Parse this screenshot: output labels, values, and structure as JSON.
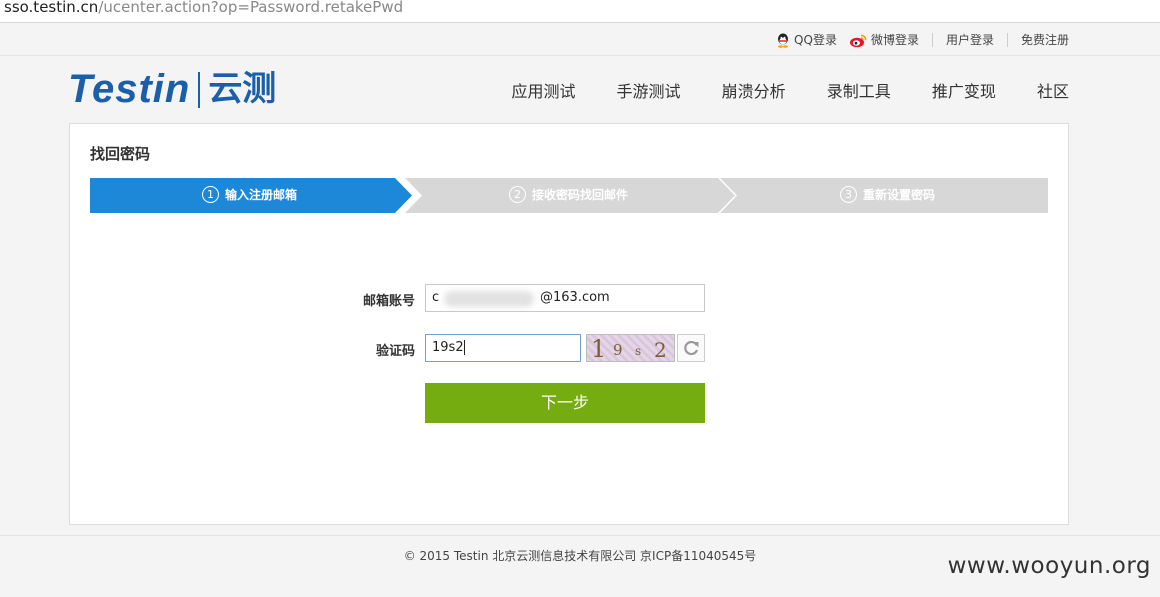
{
  "browser": {
    "url_host": "sso.testin.cn",
    "url_path": "/ucenter.action?op=Password.retakePwd"
  },
  "topbar": {
    "qq_login": "QQ登录",
    "weibo_login": "微博登录",
    "user_login": "用户登录",
    "free_register": "免费注册"
  },
  "logo": {
    "en": "Testin",
    "cn": "云测"
  },
  "nav": {
    "items": [
      "应用测试",
      "手游测试",
      "崩溃分析",
      "录制工具",
      "推广变现",
      "社区"
    ]
  },
  "panel": {
    "title": "找回密码",
    "steps": [
      {
        "num": "1",
        "label": "输入注册邮箱",
        "state": "active"
      },
      {
        "num": "2",
        "label": "接收密码找回邮件",
        "state": "inactive"
      },
      {
        "num": "3",
        "label": "重新设置密码",
        "state": "inactive"
      }
    ]
  },
  "form": {
    "email_label": "邮箱账号",
    "email_value_start": "c",
    "email_value_end": "@163.com",
    "captcha_label": "验证码",
    "captcha_value": "19s2",
    "captcha_image_chars": [
      "1",
      "9",
      "s",
      "2"
    ],
    "submit_label": "下一步"
  },
  "footer": {
    "text": "© 2015 Testin 北京云测信息技术有限公司 京ICP备11040545号"
  },
  "watermark": "www.wooyun.org",
  "colors": {
    "brand_blue": "#1b5fa8",
    "step_active": "#1e88d8",
    "step_inactive": "#d7d7d7",
    "submit_green": "#75ac0f"
  }
}
